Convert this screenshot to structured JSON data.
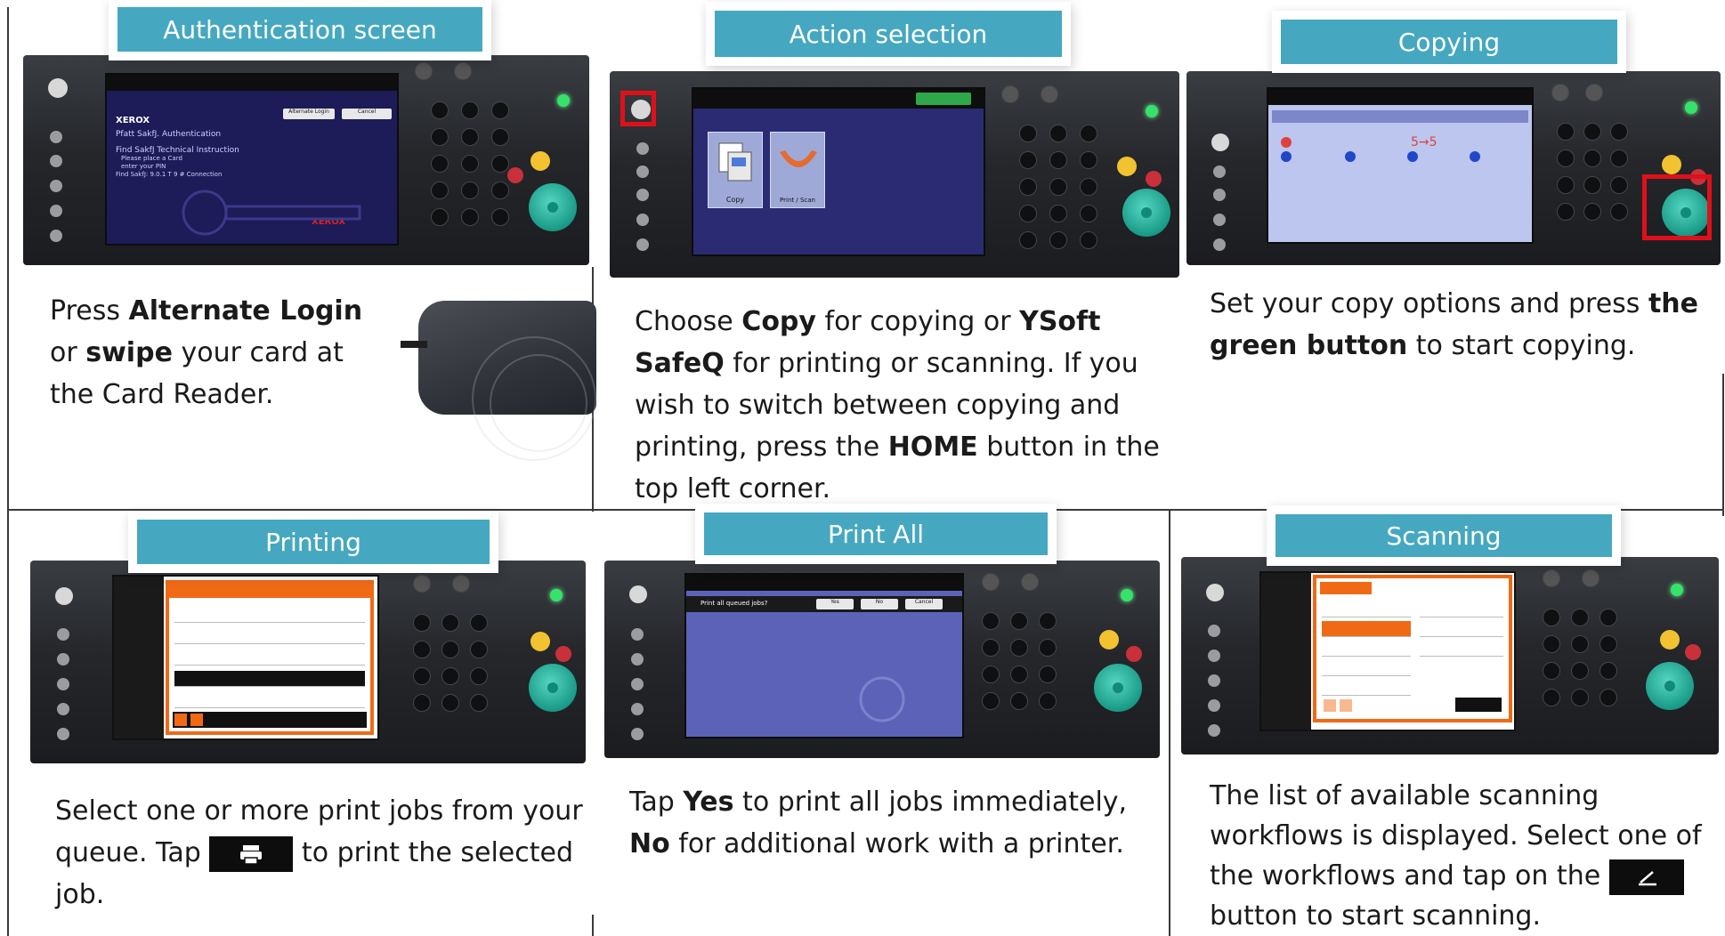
{
  "panels": {
    "auth": {
      "banner": "Authentication screen",
      "screen": {
        "brand": "XEROX",
        "lines": [
          "Pfatt SakfJ. Authentication",
          "Find SakfJ Technical Instruction",
          "Please place a Card",
          "enter your PIN",
          "Find SakfJ: 9.0.1 T 9 # Connection"
        ],
        "btn1": "Alternate Login",
        "btn2": "Cancel",
        "logo_word": "XEROX"
      },
      "text": {
        "p1": "Press ",
        "b1": "Alternate Login",
        "p2": " or ",
        "b2": "swipe",
        "p3": " your card at the Card Reader."
      }
    },
    "action": {
      "banner": "Action selection",
      "screen": {
        "tile1": "Copy",
        "tile2": "Print / Scan"
      },
      "text": {
        "p1": "Choose ",
        "b1": "Copy",
        "p2": " for copying or ",
        "b2": "YSoft SafeQ",
        "p3": " for printing or scanning. If you wish to switch between copying and printing, press the ",
        "b3": "HOME",
        "p4": " button in the top left corner."
      }
    },
    "copying": {
      "banner": "Copying",
      "text": {
        "p1": "Set your copy options and press ",
        "b1": "the green button",
        "p2": " to start copying."
      }
    },
    "printing": {
      "banner": "Printing",
      "text": {
        "p1": "Select one or more print jobs from your queue. Tap ",
        "p2": " to print the selected job."
      },
      "icon": "printer-icon"
    },
    "printall": {
      "banner": "Print All",
      "screen": {
        "question": "Print all queued jobs?",
        "yes": "Yes",
        "no": "No",
        "cancel": "Cancel"
      },
      "text": {
        "p1": "Tap ",
        "b1": "Yes",
        "p2": " to print all jobs immediately, ",
        "b2": "No",
        "p3": " for additional work with a printer."
      }
    },
    "scanning": {
      "banner": "Scanning",
      "text": {
        "p1": "The list of available scanning workflows is displayed. Select one of the workflows and tap on the ",
        "p2": " button to start scanning."
      },
      "icon": "scan-icon"
    }
  },
  "colors": {
    "banner": "#45a8c0",
    "highlight": "#e0101a",
    "safeq_orange": "#f06a16",
    "screen_blue": "#1d1b58"
  }
}
